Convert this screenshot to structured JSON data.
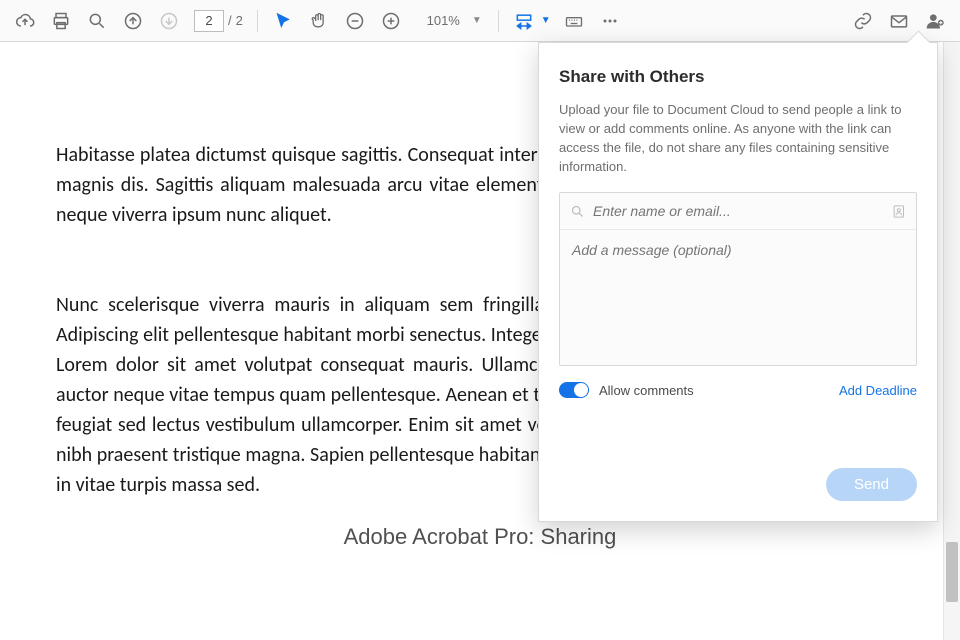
{
  "toolbar": {
    "page_current": "2",
    "page_total": "2",
    "page_sep": "/",
    "zoom": "101%"
  },
  "document": {
    "para1": "Habitasse platea dictumst quisque sagittis. Consequat interdum varius. Cum sociis natoque penatibus et magnis dis. Sagittis aliquam malesuada arcu vitae elementum curabitur. Rhoncus mattis rhoncus urna neque viverra ipsum nunc aliquet.",
    "para2": "Nunc scelerisque viverra mauris in aliquam sem fringilla. Neque aliquam bibendum enim facilisis. Adipiscing elit pellentesque habitant morbi senectus. Integer eget aliquet nibh praesent tristique magna. Lorem dolor sit amet volutpat consequat mauris. Ullamcorper eget nulla facilisi etiam. Cras semper auctor neque vitae tempus quam pellentesque. Aenean et tortor cras fermentum odio eu. Et molestie ac feugiat sed lectus vestibulum ullamcorper. Enim sit amet venenatis urna cursus eget nunc. Integer eget nibh praesent tristique magna. Sapien pellentesque habitant morbi senectus. Pretium lectus quam id leo in vitae turpis massa sed.",
    "caption": "Adobe Acrobat Pro: Sharing"
  },
  "share": {
    "title": "Share with Others",
    "desc": "Upload your file to Document Cloud to send people a link to view or add comments online. As anyone with the link can access the file, do not share any files containing sensitive information.",
    "recipient_placeholder": "Enter name or email...",
    "message_placeholder": "Add a message (optional)",
    "allow_comments": "Allow comments",
    "add_deadline": "Add Deadline",
    "send": "Send"
  }
}
